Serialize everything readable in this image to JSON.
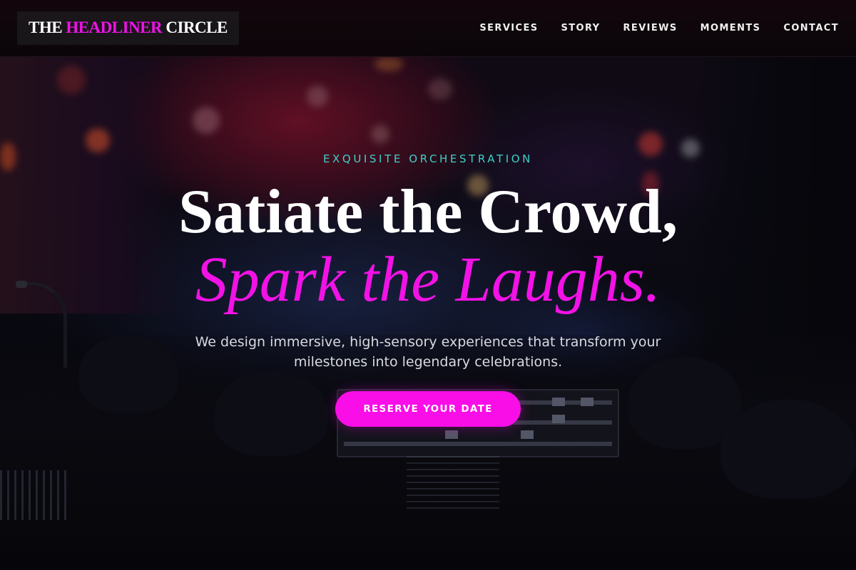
{
  "brand": {
    "part1": "THE ",
    "part2": "HEADLINER",
    "part3": " CIRCLE"
  },
  "nav": {
    "items": [
      {
        "label": "SERVICES"
      },
      {
        "label": "STORY"
      },
      {
        "label": "REVIEWS"
      },
      {
        "label": "MOMENTS"
      },
      {
        "label": "CONTACT"
      }
    ]
  },
  "hero": {
    "eyebrow": "EXQUISITE ORCHESTRATION",
    "title_line1": "Satiate the Crowd,",
    "title_line2": "Spark the Laughs.",
    "subtitle": "We design immersive, high-sensory experiences that transform your milestones into legendary celebrations.",
    "cta_label": "RESERVE YOUR DATE"
  },
  "colors": {
    "accent_magenta": "#f90ee8",
    "eyebrow_teal": "#3fd0c8",
    "navbar_bg": "#12060c"
  }
}
